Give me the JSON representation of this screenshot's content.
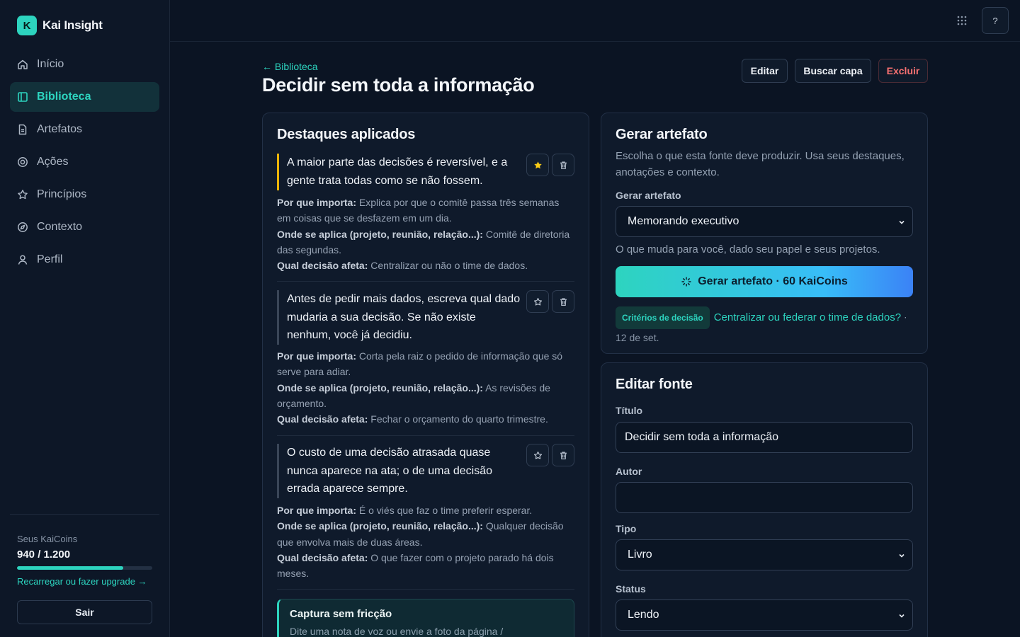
{
  "brand": {
    "logo_letter": "K",
    "name": "Kai Insight",
    "accent": "#2dd4bf"
  },
  "nav": {
    "items": [
      {
        "label": "Início",
        "icon": "home-icon",
        "active": false
      },
      {
        "label": "Biblioteca",
        "icon": "book-icon",
        "active": true
      },
      {
        "label": "Artefatos",
        "icon": "document-icon",
        "active": false
      },
      {
        "label": "Ações",
        "icon": "target-icon",
        "active": false
      },
      {
        "label": "Princípios",
        "icon": "star-icon",
        "active": false
      },
      {
        "label": "Contexto",
        "icon": "compass-icon",
        "active": false
      },
      {
        "label": "Perfil",
        "icon": "user-icon",
        "active": false
      }
    ]
  },
  "coins": {
    "label": "Seus KaiCoins",
    "value": "940 / 1.200",
    "fraction": 0.7833,
    "link": "Recarregar ou fazer upgrade →"
  },
  "logout": "Sair",
  "topbar": {
    "help": "?"
  },
  "header": {
    "back": "← Biblioteca",
    "title": "Decidir sem toda a informação",
    "edit": "Editar",
    "cover": "Buscar capa",
    "delete": "Excluir",
    "delete_color": "#f87171"
  },
  "highlights": {
    "title": "Destaques aplicados",
    "labels": {
      "why": "Por que importa:",
      "where": "Onde se aplica (projeto, reunião, relação...):",
      "decision": "Qual decisão afeta:"
    },
    "items": [
      {
        "quote": "A maior parte das decisões é reversível, e a gente trata todas como se não fossem.",
        "favorite": true,
        "why": "Explica por que o comitê passa três semanas em coisas que se desfazem em um dia.",
        "where": "Comitê de diretoria das segundas.",
        "decision": "Centralizar ou não o time de dados."
      },
      {
        "quote": "Antes de pedir mais dados, escreva qual dado mudaria a sua decisão. Se não existe nenhum, você já decidiu.",
        "favorite": false,
        "why": "Corta pela raiz o pedido de informação que só serve para adiar.",
        "where": "As revisões de orçamento.",
        "decision": "Fechar o orçamento do quarto trimestre."
      },
      {
        "quote": "O custo de uma decisão atrasada quase nunca aparece na ata; o de uma decisão errada aparece sempre.",
        "favorite": false,
        "why": "É o viés que faz o time preferir esperar.",
        "where": "Qualquer decisão que envolva mais de duas áreas.",
        "decision": "O que fazer com o projeto parado há dois meses."
      }
    ],
    "capture": {
      "title": "Captura sem fricção",
      "desc": "Dite uma nota de voz ou envie a foto da página /"
    }
  },
  "generate": {
    "title": "Gerar artefato",
    "desc": "Escolha o que esta fonte deve produzir. Usa seus destaques, anotações e contexto.",
    "select_label": "Gerar artefato",
    "selected": "Memorando executivo",
    "hint": "O que muda para você, dado seu papel e seus projetos.",
    "button": "Gerar artefato · 60 KaiCoins",
    "recent": {
      "badge": "Critérios de decisão",
      "title": "Centralizar ou federar o time de dados?",
      "sep": "·",
      "date": "12 de set."
    }
  },
  "edit_source": {
    "title": "Editar fonte",
    "title_label": "Título",
    "title_value": "Decidir sem toda a informação",
    "author_label": "Autor",
    "author_value": "",
    "type_label": "Tipo",
    "type_value": "Livro",
    "status_label": "Status",
    "status_value": "Lendo"
  }
}
